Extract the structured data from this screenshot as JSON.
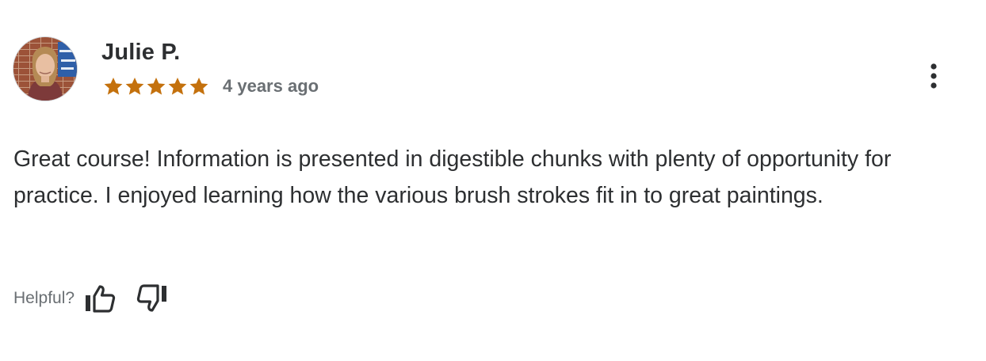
{
  "review": {
    "reviewer_name": "Julie P.",
    "rating": 5,
    "rating_max": 5,
    "star_color": "#c4710d",
    "time_ago": "4 years ago",
    "text": "Great course! Information is presented in digestible chunks with plenty of opportunity for practice. I enjoyed learning how the various brush strokes fit in to great paintings.",
    "more_icon": "more-vertical-icon"
  },
  "feedback": {
    "helpful_label": "Helpful?",
    "thumbs_up_icon": "thumbs-up-icon",
    "thumbs_down_icon": "thumbs-down-icon"
  }
}
